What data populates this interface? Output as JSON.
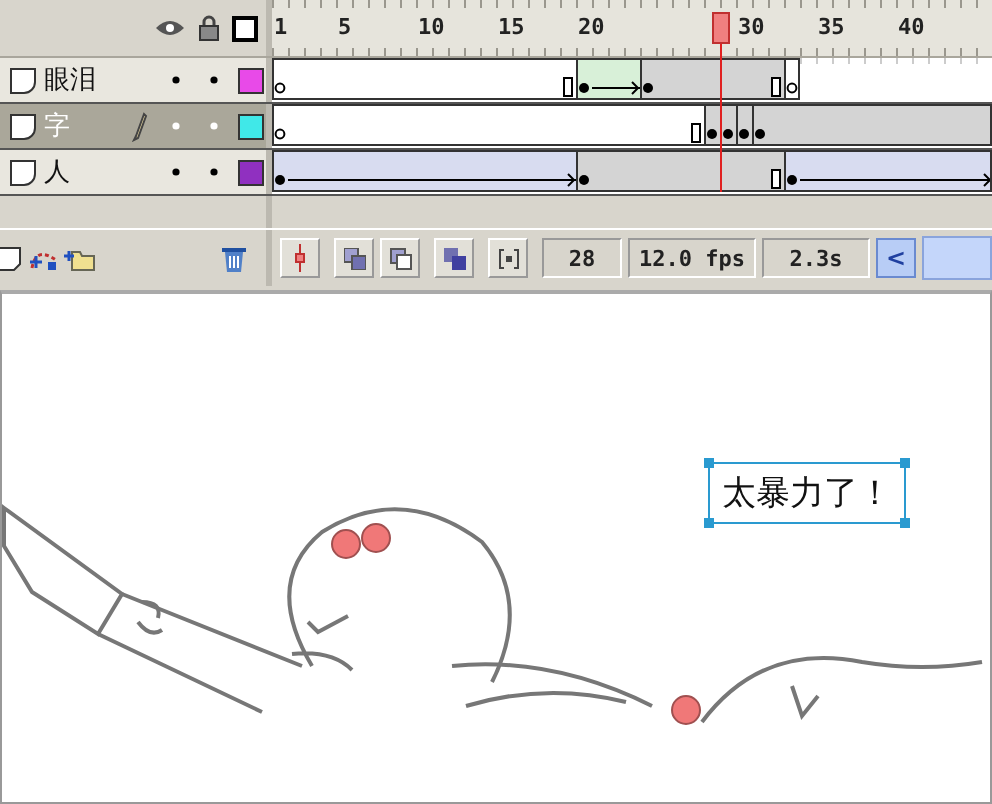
{
  "timeline": {
    "ruler": [
      "1",
      "5",
      "10",
      "15",
      "20",
      "30",
      "35",
      "40"
    ],
    "layers": [
      {
        "name": "眼泪",
        "selected": false,
        "editing": false,
        "hidden": false,
        "locked": false,
        "color": "#e84ae8",
        "frames": [
          {
            "kind": "blank-key"
          },
          {
            "kind": "blank"
          },
          {
            "kind": "blank"
          },
          {
            "kind": "blank"
          },
          {
            "kind": "blank"
          },
          {
            "kind": "blank"
          },
          {
            "kind": "blank"
          },
          {
            "kind": "blank"
          },
          {
            "kind": "blank"
          },
          {
            "kind": "blank"
          },
          {
            "kind": "blank"
          },
          {
            "kind": "blank"
          },
          {
            "kind": "blank"
          },
          {
            "kind": "blank"
          },
          {
            "kind": "blank"
          },
          {
            "kind": "blank"
          },
          {
            "kind": "blank"
          },
          {
            "kind": "blank"
          },
          {
            "kind": "blank-end"
          },
          {
            "kind": "shape-key"
          },
          {
            "kind": "shape"
          },
          {
            "kind": "shape"
          },
          {
            "kind": "shape"
          },
          {
            "kind": "key"
          },
          {
            "kind": "frame"
          },
          {
            "kind": "frame"
          },
          {
            "kind": "frame"
          },
          {
            "kind": "frame"
          },
          {
            "kind": "frame"
          },
          {
            "kind": "frame"
          },
          {
            "kind": "frame"
          },
          {
            "kind": "end"
          },
          {
            "kind": "blank-key"
          }
        ]
      },
      {
        "name": "字",
        "selected": true,
        "editing": true,
        "hidden": false,
        "locked": false,
        "color": "#40e8e8",
        "frames": [
          {
            "kind": "blank-key"
          },
          {
            "kind": "blank"
          },
          {
            "kind": "blank"
          },
          {
            "kind": "blank"
          },
          {
            "kind": "blank"
          },
          {
            "kind": "blank"
          },
          {
            "kind": "blank"
          },
          {
            "kind": "blank"
          },
          {
            "kind": "blank"
          },
          {
            "kind": "blank"
          },
          {
            "kind": "blank"
          },
          {
            "kind": "blank"
          },
          {
            "kind": "blank"
          },
          {
            "kind": "blank"
          },
          {
            "kind": "blank"
          },
          {
            "kind": "blank"
          },
          {
            "kind": "blank"
          },
          {
            "kind": "blank"
          },
          {
            "kind": "blank"
          },
          {
            "kind": "blank"
          },
          {
            "kind": "blank"
          },
          {
            "kind": "blank"
          },
          {
            "kind": "blank"
          },
          {
            "kind": "blank"
          },
          {
            "kind": "blank"
          },
          {
            "kind": "blank"
          },
          {
            "kind": "blank-end"
          },
          {
            "kind": "key"
          },
          {
            "kind": "key"
          },
          {
            "kind": "key"
          },
          {
            "kind": "key"
          },
          {
            "kind": "frame"
          },
          {
            "kind": "frame"
          },
          {
            "kind": "frame"
          },
          {
            "kind": "frame"
          },
          {
            "kind": "frame"
          },
          {
            "kind": "frame"
          },
          {
            "kind": "frame"
          },
          {
            "kind": "frame"
          },
          {
            "kind": "frame"
          },
          {
            "kind": "frame"
          },
          {
            "kind": "frame"
          },
          {
            "kind": "frame"
          },
          {
            "kind": "frame"
          },
          {
            "kind": "frame"
          }
        ]
      },
      {
        "name": "人",
        "selected": false,
        "editing": false,
        "hidden": false,
        "locked": false,
        "color": "#9030c0",
        "frames": [
          {
            "kind": "motion-key"
          },
          {
            "kind": "motion"
          },
          {
            "kind": "motion"
          },
          {
            "kind": "motion"
          },
          {
            "kind": "motion"
          },
          {
            "kind": "motion"
          },
          {
            "kind": "motion"
          },
          {
            "kind": "motion"
          },
          {
            "kind": "motion"
          },
          {
            "kind": "motion"
          },
          {
            "kind": "motion"
          },
          {
            "kind": "motion"
          },
          {
            "kind": "motion"
          },
          {
            "kind": "motion"
          },
          {
            "kind": "motion"
          },
          {
            "kind": "motion"
          },
          {
            "kind": "motion"
          },
          {
            "kind": "motion"
          },
          {
            "kind": "motion"
          },
          {
            "kind": "key"
          },
          {
            "kind": "frame"
          },
          {
            "kind": "frame"
          },
          {
            "kind": "frame"
          },
          {
            "kind": "frame"
          },
          {
            "kind": "frame"
          },
          {
            "kind": "frame"
          },
          {
            "kind": "frame"
          },
          {
            "kind": "frame"
          },
          {
            "kind": "frame"
          },
          {
            "kind": "frame"
          },
          {
            "kind": "frame"
          },
          {
            "kind": "end"
          },
          {
            "kind": "motion-key"
          },
          {
            "kind": "motion"
          },
          {
            "kind": "motion"
          },
          {
            "kind": "motion"
          },
          {
            "kind": "motion"
          },
          {
            "kind": "motion"
          },
          {
            "kind": "motion"
          },
          {
            "kind": "motion"
          },
          {
            "kind": "motion"
          },
          {
            "kind": "motion"
          },
          {
            "kind": "motion"
          },
          {
            "kind": "motion"
          },
          {
            "kind": "motion"
          }
        ]
      }
    ],
    "status": {
      "current_frame": "28",
      "frame_rate": "12.0 fps",
      "elapsed": "2.3s",
      "scroll_left": "<"
    }
  },
  "stage": {
    "text_box": "太暴力了！"
  }
}
